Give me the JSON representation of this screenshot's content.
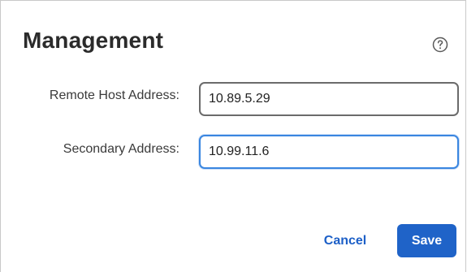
{
  "dialog": {
    "title": "Management",
    "help_icon": "question-circle-icon"
  },
  "fields": {
    "remote_host": {
      "label": "Remote Host Address:",
      "value": "10.89.5.29"
    },
    "secondary": {
      "label": "Secondary Address:",
      "value": "10.99.11.6"
    }
  },
  "actions": {
    "cancel_label": "Cancel",
    "save_label": "Save"
  },
  "colors": {
    "primary": "#1f63c8",
    "focus_border": "#3a86e0",
    "title": "#2b2b2b"
  }
}
